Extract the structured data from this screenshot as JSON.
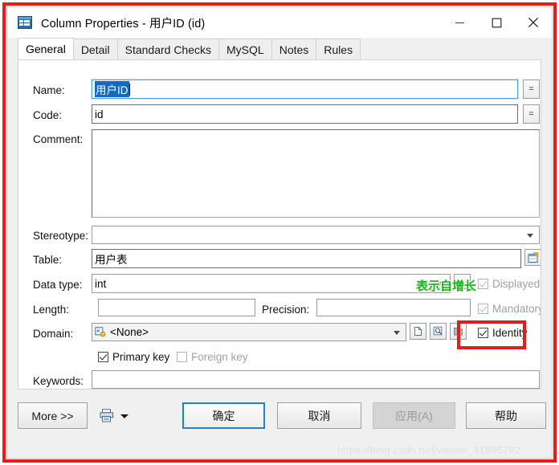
{
  "window": {
    "title": "Column Properties - 用户ID (id)",
    "app_icon": "table-grid-icon",
    "minimize_label": "–",
    "maximize_label": "□",
    "close_label": "✕"
  },
  "tabs": [
    {
      "label": "General",
      "active": true
    },
    {
      "label": "Detail",
      "active": false
    },
    {
      "label": "Standard Checks",
      "active": false
    },
    {
      "label": "MySQL",
      "active": false
    },
    {
      "label": "Notes",
      "active": false
    },
    {
      "label": "Rules",
      "active": false
    }
  ],
  "form": {
    "name": {
      "label": "Name:",
      "value": "用户ID",
      "selected": true,
      "side_button": "="
    },
    "code": {
      "label": "Code:",
      "value": "id",
      "side_button": "="
    },
    "comment": {
      "label": "Comment:",
      "value": ""
    },
    "stereotype": {
      "label": "Stereotype:",
      "value": ""
    },
    "table": {
      "label": "Table:",
      "value": "用户表",
      "side_button_icon": "table-properties-icon"
    },
    "datatype": {
      "label": "Data type:",
      "value": "int"
    },
    "length": {
      "label": "Length:",
      "value": ""
    },
    "precision": {
      "label": "Precision:",
      "value": ""
    },
    "domain": {
      "label": "Domain:",
      "value": "<None>",
      "icon": "domain-icon",
      "buttons": [
        "new-domain-icon",
        "browse-domain-icon",
        "open-domain-icon"
      ]
    },
    "keywords": {
      "label": "Keywords:",
      "value": ""
    },
    "checkboxes": {
      "displayed": {
        "label": "Displayed",
        "checked": true,
        "enabled": false
      },
      "mandatory": {
        "label": "Mandatory",
        "checked": true,
        "enabled": false
      },
      "identity": {
        "label": "Identity",
        "checked": true,
        "enabled": true
      },
      "primary_key": {
        "label": "Primary key",
        "checked": true,
        "enabled": true
      },
      "foreign_key": {
        "label": "Foreign key",
        "checked": false,
        "enabled": false
      }
    }
  },
  "annotations": {
    "green_note": "表示自增长",
    "green_color": "#17b317",
    "highlight_color": "#e81b1b"
  },
  "footer": {
    "more": "More >>",
    "print_icon": "printer-icon",
    "print_dropdown": "chevron-down-icon",
    "ok": "确定",
    "cancel": "取消",
    "apply": "应用(A)",
    "help": "帮助"
  },
  "watermark": "https://blog.csdn.net/weixin_41805792"
}
